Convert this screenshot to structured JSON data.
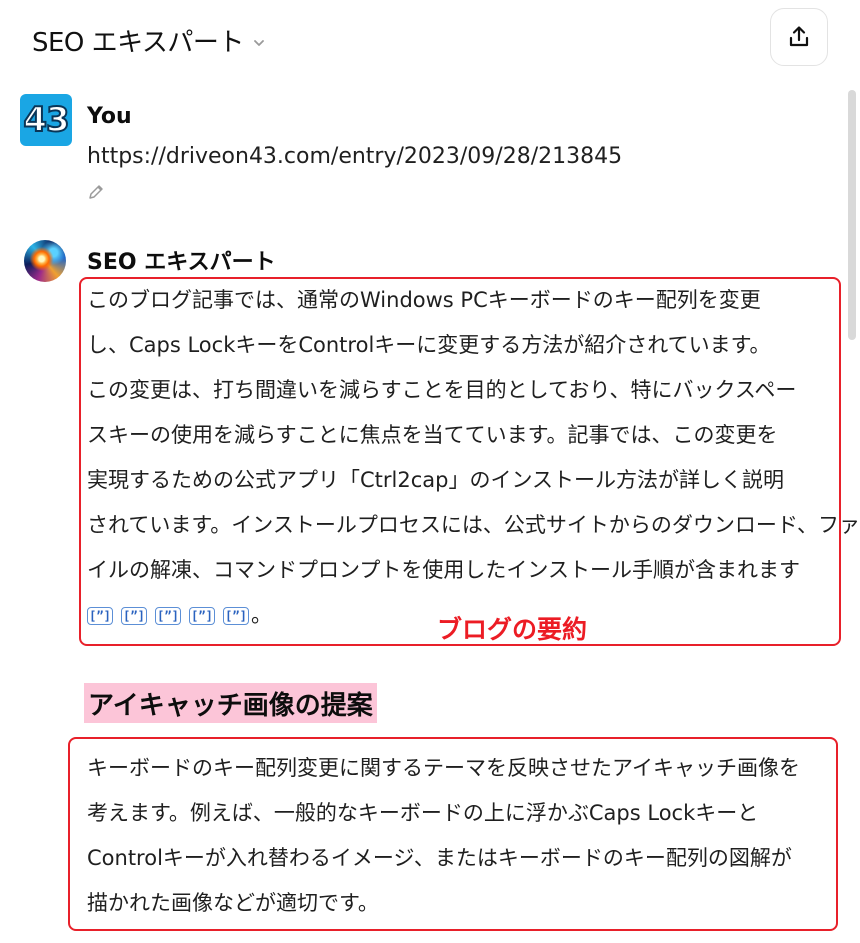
{
  "header": {
    "title": "SEO エキスパート",
    "chevron_icon": "chevron-down-icon",
    "share_icon": "share-upload-icon"
  },
  "user_message": {
    "avatar_text": "43",
    "author": "You",
    "text": "https://driveon43.com/entry/2023/09/28/213845",
    "edit_icon": "pencil-icon"
  },
  "assistant_message": {
    "author": "SEO エキスパート",
    "summary_lines": [
      "このブログ記事では、通常のWindows PCキーボードのキー配列を変更",
      "し、Caps LockキーをControlキーに変更する方法が紹介されています。",
      "この変更は、打ち間違いを減らすことを目的としており、特にバックスペー",
      "スキーの使用を減らすことに焦点を当てています。記事では、この変更を",
      "実現するための公式アプリ「Ctrl2cap」のインストール方法が詳しく説明",
      "されています。インストールプロセスには、公式サイトからのダウンロード、ファ",
      "イルの解凍、コマンドプロンプトを使用したインストール手順が含まれます"
    ],
    "citations": [
      "[”]",
      "[”]",
      "[”]",
      "[”]",
      "[”]"
    ],
    "citation_end": "。",
    "summary_annotation": "ブログの要約",
    "heading": "アイキャッチ画像の提案",
    "eyecatch_lines": [
      "キーボードのキー配列変更に関するテーマを反映させたアイキャッチ画像を",
      "考えます。例えば、一般的なキーボードの上に浮かぶCaps Lockキーと",
      "Controlキーが入れ替わるイメージ、またはキーボードのキー配列の図解が",
      "描かれた画像などが適切です。"
    ]
  },
  "colors": {
    "annotation_red": "#e8202a",
    "heading_highlight": "#fcc5d8",
    "citation_blue": "#2a62bf",
    "avatar_blue": "#1aa6e4"
  }
}
